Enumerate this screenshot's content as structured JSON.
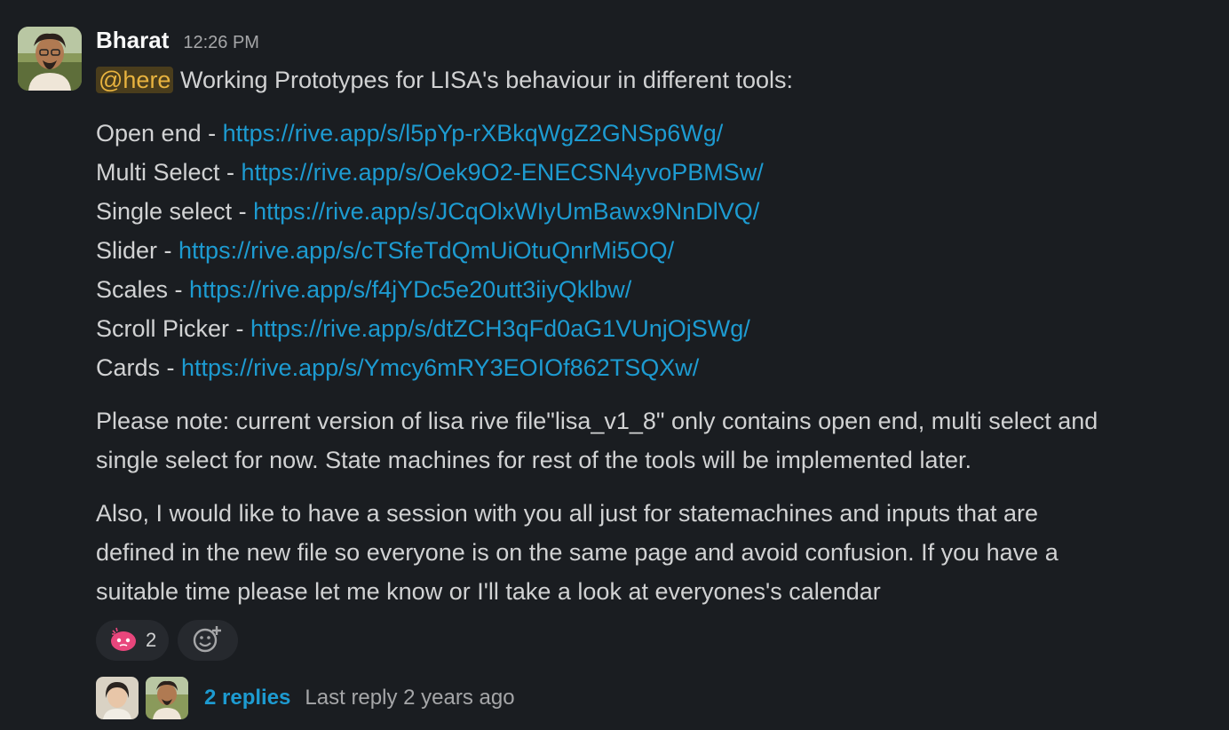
{
  "message": {
    "sender": "Bharat",
    "timestamp": "12:26 PM",
    "mention": "@here",
    "intro": "Working Prototypes for LISA's behaviour in different tools:",
    "links": [
      {
        "label": "Open end - ",
        "url": "https://rive.app/s/l5pYp-rXBkqWgZ2GNSp6Wg/"
      },
      {
        "label": "Multi Select - ",
        "url": "https://rive.app/s/Oek9O2-ENECSN4yvoPBMSw/"
      },
      {
        "label": "Single select - ",
        "url": "https://rive.app/s/JCqOlxWIyUmBawx9NnDlVQ/"
      },
      {
        "label": "Slider - ",
        "url": "https://rive.app/s/cTSfeTdQmUiOtuQnrMi5OQ/"
      },
      {
        "label": "Scales - ",
        "url": "https://rive.app/s/f4jYDc5e20utt3iiyQklbw/"
      },
      {
        "label": "Scroll Picker - ",
        "url": "https://rive.app/s/dtZCH3qFd0aG1VUnjOjSWg/"
      },
      {
        "label": "Cards - ",
        "url": "https://rive.app/s/Ymcy6mRY3EOIOf862TSQXw/"
      }
    ],
    "note_lines": [
      "Please note: current version of lisa rive file\"lisa_v1_8\" only contains open end, multi select and",
      "single select for now. State machines for rest of the tools will be implemented later."
    ],
    "session_lines": [
      "Also, I would like to have a session with you all just for statemachines and inputs that are",
      "defined in the new file so everyone is on the same page and avoid confusion. If you have a",
      "suitable time please let me know or I'll take a look at everyones's calendar"
    ]
  },
  "reactions": [
    {
      "icon": "pink-blob-emoji-icon",
      "count": "2"
    }
  ],
  "add_reaction_icon": "add-reaction-icon",
  "thread": {
    "replies": "2 replies",
    "last_reply": "Last reply 2 years ago"
  },
  "colors": {
    "background": "#1a1d21",
    "link": "#1d9bd1",
    "mention_bg": "#4a3d1c",
    "mention_text": "#e8b33f"
  }
}
